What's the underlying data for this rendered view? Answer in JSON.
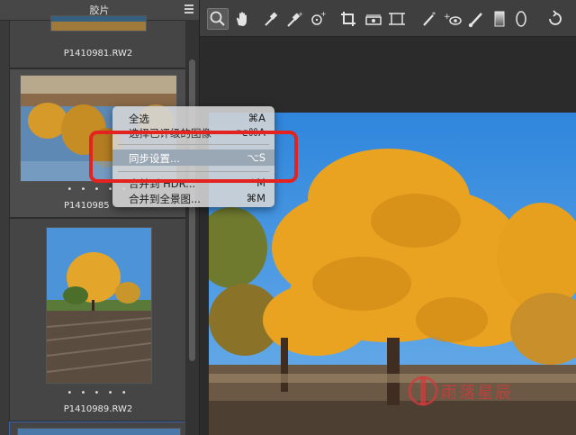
{
  "filmstrip": {
    "title": "胶片",
    "items": [
      {
        "name": "P1410981.RW2",
        "dots": ""
      },
      {
        "name": "P1410985",
        "dots": "• • • • •"
      },
      {
        "name": "P1410989.RW2",
        "dots": "• • • • •"
      }
    ]
  },
  "context_menu": {
    "items": [
      {
        "label": "全选",
        "shortcut": "⌘A"
      },
      {
        "label": "选择已评级的图像",
        "shortcut": "⌥⌘A"
      },
      {
        "label": "同步设置...",
        "shortcut": "⌥S"
      },
      {
        "label": "合并到 HDR...",
        "shortcut": "⌃M"
      },
      {
        "label": "合并到全景图...",
        "shortcut": "⌘M"
      }
    ]
  },
  "toolbar": {
    "tools": [
      "zoom-icon",
      "hand-icon",
      "white-balance-icon",
      "color-sampler-icon",
      "target-adjust-icon",
      "crop-icon",
      "straighten-icon",
      "transform-icon",
      "spot-removal-icon",
      "red-eye-icon",
      "adjustment-brush-icon",
      "graduated-filter-icon",
      "radial-filter-icon",
      "rotate-icon"
    ]
  },
  "watermark": {
    "text": "雨落星辰"
  },
  "colors": {
    "highlight": "#e3231f",
    "sky": "#3f8fd8",
    "foliage": "#e9a320"
  }
}
